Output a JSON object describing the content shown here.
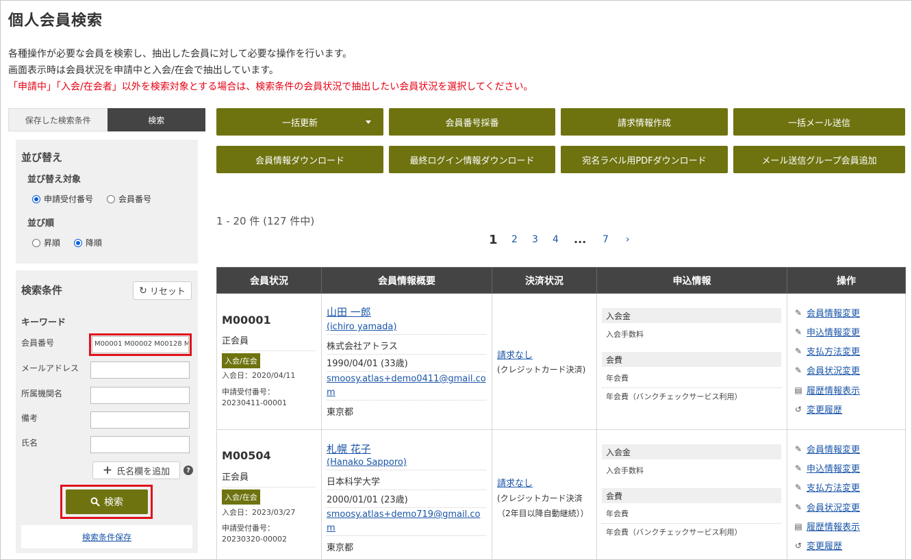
{
  "page": {
    "title": "個人会員検索",
    "desc1": "各種操作が必要な会員を検索し、抽出した会員に対して必要な操作を行います。",
    "desc2": "画面表示時は会員状況を申請中と入会/在会で抽出しています。",
    "desc3": "「申請中」「入会/在会者」以外を検索対象とする場合は、検索条件の会員状況で抽出したい会員状況を選択してください。"
  },
  "sidebar": {
    "tab_saved": "保存した検索条件",
    "tab_search": "検索",
    "sort": {
      "heading": "並び替え",
      "target_label": "並び替え対象",
      "target_options": [
        "申請受付番号",
        "会員番号"
      ],
      "target_selected": "申請受付番号",
      "order_label": "並び順",
      "order_options": [
        "昇順",
        "降順"
      ],
      "order_selected": "降順"
    },
    "search": {
      "heading": "検索条件",
      "reset_label": "リセット",
      "keyword_label": "キーワード",
      "fields": [
        {
          "label": "会員番号",
          "value": "M00001 M00002 M00128 M"
        },
        {
          "label": "メールアドレス",
          "value": ""
        },
        {
          "label": "所属機関名",
          "value": ""
        },
        {
          "label": "備考",
          "value": ""
        },
        {
          "label": "氏名",
          "value": ""
        }
      ],
      "add_name_label": "氏名欄を追加",
      "help_glyph": "?",
      "search_label": "検索",
      "save_label": "検索条件保存"
    }
  },
  "actions": {
    "bulk_update": "一括更新",
    "assign_number": "会員番号採番",
    "create_billing": "請求情報作成",
    "bulk_mail": "一括メール送信",
    "download_info": "会員情報ダウンロード",
    "download_login": "最終ログイン情報ダウンロード",
    "download_label_pdf": "宛名ラベル用PDFダウンロード",
    "add_mail_group": "メール送信グループ会員追加"
  },
  "results": {
    "count_text": "1 - 20 件 (127 件中)",
    "pages": [
      "1",
      "2",
      "3",
      "4",
      "...",
      "7",
      "›"
    ],
    "current_page": "1"
  },
  "table": {
    "headers": [
      "会員状況",
      "会員情報概要",
      "決済状況",
      "申込情報",
      "操作"
    ],
    "rows": [
      {
        "member_no": "M00001",
        "member_type": "正会員",
        "status_badge": "入会/在会",
        "join_date": "入会日：2020/04/11",
        "app_no_label": "申請受付番号：",
        "app_no": "20230411-00001",
        "name": "山田 一郎",
        "name_kana": "(ichiro yamada)",
        "org": "株式会社アトラス",
        "birth": "1990/04/01 (33歳)",
        "email_1": "smoosy.atlas+demo0411@gmail.co",
        "email_2": "m",
        "region": "東京都",
        "payment_link": "請求なし",
        "payment_method": "(クレジットカード決済)",
        "payment_note": "",
        "entry_fee_h": "入会金",
        "entry_fee_v": "入会手数料",
        "annual_fee_h": "会費",
        "annual_fee_v": "年会費",
        "annual_fee_v2": "年会費（バンクチェックサービス利用）"
      },
      {
        "member_no": "M00504",
        "member_type": "正会員",
        "status_badge": "入会/在会",
        "join_date": "入会日：2023/03/27",
        "app_no_label": "申請受付番号：",
        "app_no": "20230320-00002",
        "name": "札幌 花子",
        "name_kana": "(Hanako Sapporo)",
        "org": "日本科学大学",
        "birth": "2000/01/01 (23歳)",
        "email_1": "smoosy.atlas+demo719@gmail.co",
        "email_2": "m",
        "region": "東京都",
        "payment_link": "請求なし",
        "payment_method": "(クレジットカード決済",
        "payment_note": "（2年目以降自動継続））",
        "entry_fee_h": "入会金",
        "entry_fee_v": "入会手数料",
        "annual_fee_h": "会費",
        "annual_fee_v": "年会費",
        "annual_fee_v2": "年会費（バンクチェックサービス利用）"
      }
    ],
    "operations": [
      {
        "label": "会員情報変更",
        "icon": "pencil-icon"
      },
      {
        "label": "申込情報変更",
        "icon": "pencil-icon"
      },
      {
        "label": "支払方法変更",
        "icon": "pencil-icon"
      },
      {
        "label": "会員状況変更",
        "icon": "pencil-icon"
      },
      {
        "label": "履歴情報表示",
        "icon": "document-icon"
      },
      {
        "label": "変更履歴",
        "icon": "history-icon"
      }
    ]
  },
  "colors": {
    "accent": "#6e7310",
    "header": "#444444",
    "highlight": "#e0101a",
    "link": "#1a55a8",
    "alert": "#e60012"
  }
}
